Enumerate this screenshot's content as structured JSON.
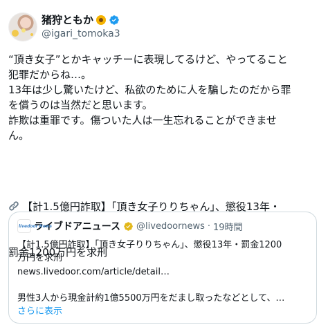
{
  "author": {
    "display_name": "猪狩ともか",
    "handle": "@igari_tomoka3",
    "avatar_icon": "profile-photo",
    "name_emoji_icon": "sunflower-icon",
    "verified_color": "#1d9bf0"
  },
  "post": {
    "lines": [
      "“頂き女子”とかキャッチーに表現してるけど、やってること",
      "犯罪だからね…。",
      "13年は少し驚いたけど、私欲のために人を騙したのだから罪",
      "を償うのは当然だと思います。",
      "詐欺は重罪です。傷ついた人は一生忘れることができませ",
      "ん。"
    ],
    "link_icon": "link-icon",
    "link_text_line1": "【計1.5億円詐取】「頂き女子りりちゃん」、懲役13年・",
    "link_text_line2": "罰金1200万円を求刑"
  },
  "quote": {
    "source_logo_text": "livedoor News",
    "display_name": "ライブドアニュース",
    "verified_color": "#e2b719",
    "handle": "@livedoornews",
    "separator": "·",
    "time": "19時間",
    "text_line1": "【計1.5億円詐取】「頂き女子りりちゃん」、懲役13年・罰金1200",
    "text_line2": "万円を求刑",
    "url": "news.livedoor.com/article/detail…",
    "summary": "男性3人から現金計約1億5500万円をだまし取ったなどとして、…",
    "show_more": "さらに表示",
    "link_color": "#1d9bf0"
  }
}
